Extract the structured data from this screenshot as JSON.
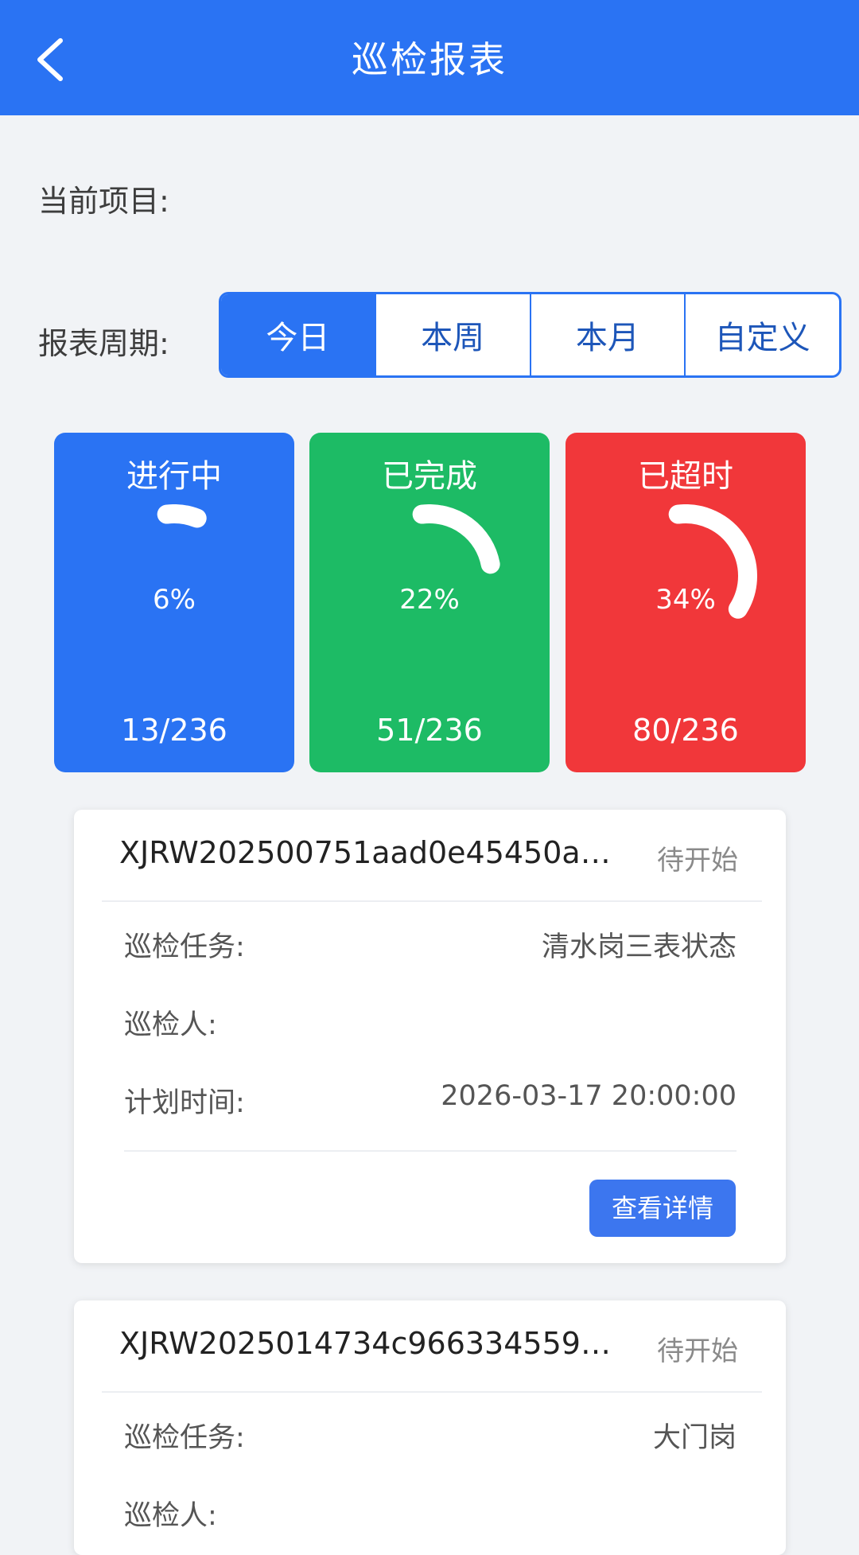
{
  "header": {
    "title": "巡检报表",
    "back_icon": "chevron-left-icon"
  },
  "filters": {
    "project_label": "当前项目:",
    "period_label": "报表周期:",
    "periods": [
      "今日",
      "本周",
      "本月",
      "自定义"
    ],
    "active_period": "今日"
  },
  "stats": [
    {
      "title": "进行中",
      "percent_text": "6%",
      "percent": 6,
      "count": "13/236",
      "color": "#2a73f3"
    },
    {
      "title": "已完成",
      "percent_text": "22%",
      "percent": 22,
      "count": "51/236",
      "color": "#1dbb65"
    },
    {
      "title": "已超时",
      "percent_text": "34%",
      "percent": 34,
      "count": "80/236",
      "color": "#f1373a"
    }
  ],
  "tasks": [
    {
      "code": "XJRW202500751aad0e45450a9...",
      "status": "待开始",
      "task_label": "巡检任务:",
      "task_value": "清水岗三表状态",
      "inspector_label": "巡检人:",
      "inspector_value": "",
      "time_label": "计划时间:",
      "time_value": "2026-03-17 20:00:00",
      "button": "查看详情"
    },
    {
      "code": "XJRW2025014734c9663345598...",
      "status": "待开始",
      "task_label": "巡检任务:",
      "task_value": "大门岗",
      "inspector_label": "巡检人:",
      "inspector_value": ""
    }
  ]
}
